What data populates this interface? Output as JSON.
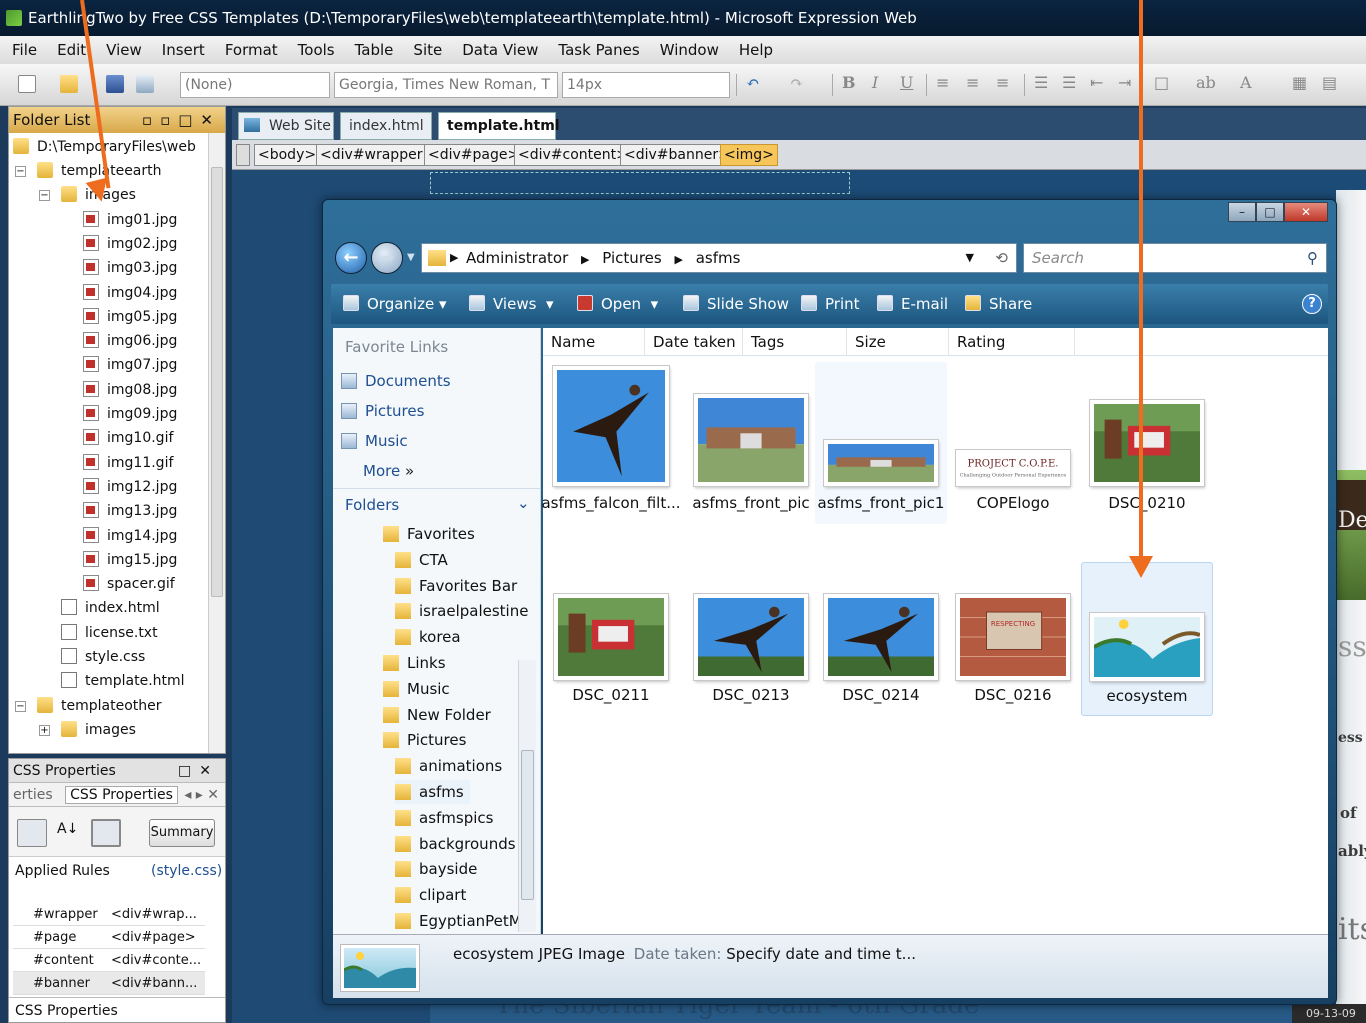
{
  "app": {
    "title": "EarthlingTwo by Free CSS Templates (D:\\TemporaryFiles\\web\\templateearth\\template.html) - Microsoft Expression Web",
    "menu": [
      "File",
      "Edit",
      "View",
      "Insert",
      "Format",
      "Tools",
      "Table",
      "Site",
      "Data View",
      "Task Panes",
      "Window",
      "Help"
    ],
    "toolbar": {
      "style_select": "(None)",
      "font_select": "Georgia, Times New Roman, T",
      "size_select": "14px"
    }
  },
  "folder_list": {
    "title": "Folder List",
    "root": "D:\\TemporaryFiles\\web",
    "items": [
      {
        "label": "templateearth",
        "kind": "folder",
        "level": 1,
        "expander": "−"
      },
      {
        "label": "images",
        "kind": "folder",
        "level": 2,
        "expander": "−"
      },
      {
        "label": "img01.jpg",
        "kind": "img",
        "level": 3
      },
      {
        "label": "img02.jpg",
        "kind": "img",
        "level": 3
      },
      {
        "label": "img03.jpg",
        "kind": "img",
        "level": 3
      },
      {
        "label": "img04.jpg",
        "kind": "img",
        "level": 3
      },
      {
        "label": "img05.jpg",
        "kind": "img",
        "level": 3
      },
      {
        "label": "img06.jpg",
        "kind": "img",
        "level": 3
      },
      {
        "label": "img07.jpg",
        "kind": "img",
        "level": 3
      },
      {
        "label": "img08.jpg",
        "kind": "img",
        "level": 3
      },
      {
        "label": "img09.jpg",
        "kind": "img",
        "level": 3
      },
      {
        "label": "img10.gif",
        "kind": "img",
        "level": 3
      },
      {
        "label": "img11.gif",
        "kind": "img",
        "level": 3
      },
      {
        "label": "img12.jpg",
        "kind": "img",
        "level": 3
      },
      {
        "label": "img13.jpg",
        "kind": "img",
        "level": 3
      },
      {
        "label": "img14.jpg",
        "kind": "img",
        "level": 3
      },
      {
        "label": "img15.jpg",
        "kind": "img",
        "level": 3
      },
      {
        "label": "spacer.gif",
        "kind": "img",
        "level": 3
      },
      {
        "label": "index.html",
        "kind": "doc",
        "level": 2
      },
      {
        "label": "license.txt",
        "kind": "doc",
        "level": 2
      },
      {
        "label": "style.css",
        "kind": "doc",
        "level": 2
      },
      {
        "label": "template.html",
        "kind": "doc",
        "level": 2
      },
      {
        "label": "templateother",
        "kind": "folder",
        "level": 1,
        "expander": "−"
      },
      {
        "label": "images",
        "kind": "folder",
        "level": 2,
        "expander": "+"
      }
    ]
  },
  "css_panel": {
    "title": "CSS Properties",
    "tab_left": "erties",
    "tab_active": "CSS Properties",
    "summary_label": "Summary",
    "applied_rules_label": "Applied Rules",
    "applied_rules_source": "(style.css)",
    "rules": [
      {
        "selector": "#wrapper",
        "element": "<div#wrap..."
      },
      {
        "selector": "#page",
        "element": "<div#page>"
      },
      {
        "selector": "#content",
        "element": "<div#conte..."
      },
      {
        "selector": "#banner",
        "element": "<div#bann..."
      }
    ],
    "footer_label": "CSS Properties"
  },
  "editor": {
    "tabs": [
      "Web Site",
      "index.html",
      "template.html"
    ],
    "active_tab": "template.html",
    "breadcrumbs": [
      "<body>",
      "<div#wrapper>",
      "<div#page>",
      "<div#content>",
      "<div#banner>",
      "<img>"
    ],
    "bg_text": {
      "heading": "The Siberian Tiger Team - 6th Grade",
      "right_de": "De",
      "right_ss": "ss",
      "right_ess": "ess",
      "right_of": "of",
      "right_ably": "ably",
      "right_its": "its",
      "right_date": "09-13-09"
    }
  },
  "explorer": {
    "address": [
      "Administrator",
      "Pictures",
      "asfms"
    ],
    "search_placeholder": "Search",
    "commands": [
      "Organize",
      "Views",
      "Open",
      "Slide Show",
      "Print",
      "E-mail",
      "Share"
    ],
    "help_glyph": "?",
    "favorite_links_label": "Favorite Links",
    "favorite_links": [
      "Documents",
      "Pictures",
      "Music"
    ],
    "more_label": "More",
    "folders_label": "Folders",
    "folders": [
      {
        "label": "Favorites",
        "level": 1
      },
      {
        "label": "CTA",
        "level": 2
      },
      {
        "label": "Favorites Bar",
        "level": 2
      },
      {
        "label": "israelpalestine",
        "level": 2
      },
      {
        "label": "korea",
        "level": 2
      },
      {
        "label": "Links",
        "level": 1
      },
      {
        "label": "Music",
        "level": 1
      },
      {
        "label": "New Folder",
        "level": 1
      },
      {
        "label": "Pictures",
        "level": 1
      },
      {
        "label": "animations",
        "level": 2
      },
      {
        "label": "asfms",
        "level": 2
      },
      {
        "label": "asfmspics",
        "level": 2
      },
      {
        "label": "backgrounds",
        "level": 2
      },
      {
        "label": "bayside",
        "level": 2
      },
      {
        "label": "clipart",
        "level": 2
      },
      {
        "label": "EgyptianPetM",
        "level": 2
      }
    ],
    "columns": [
      "Name",
      "Date taken",
      "Tags",
      "Size",
      "Rating"
    ],
    "files": [
      {
        "name": "asfms_falcon_filt...",
        "kind": "falcon"
      },
      {
        "name": "asfms_front_pic",
        "kind": "building"
      },
      {
        "name": "asfms_front_pic1",
        "kind": "building2"
      },
      {
        "name": "COPElogo",
        "kind": "logo"
      },
      {
        "name": "DSC_0210",
        "kind": "sign"
      },
      {
        "name": "DSC_0211",
        "kind": "sign2"
      },
      {
        "name": "DSC_0213",
        "kind": "falcon2"
      },
      {
        "name": "DSC_0214",
        "kind": "falcon3"
      },
      {
        "name": "DSC_0216",
        "kind": "brick"
      },
      {
        "name": "ecosystem",
        "kind": "eco"
      }
    ],
    "logo_text": "PROJECT C.O.P.E.",
    "logo_subtext": "Challenging Outdoor Personal Experience",
    "sign_text": "RESPECTING",
    "status": {
      "name": "ecosystem",
      "type": "JPEG Image",
      "date_label": "Date taken:",
      "date_value": "Specify date and time t..."
    }
  },
  "colors": {
    "accent": "#ee6c1e",
    "window_blue": "#1d567f",
    "selection": "#e6f1fb"
  }
}
